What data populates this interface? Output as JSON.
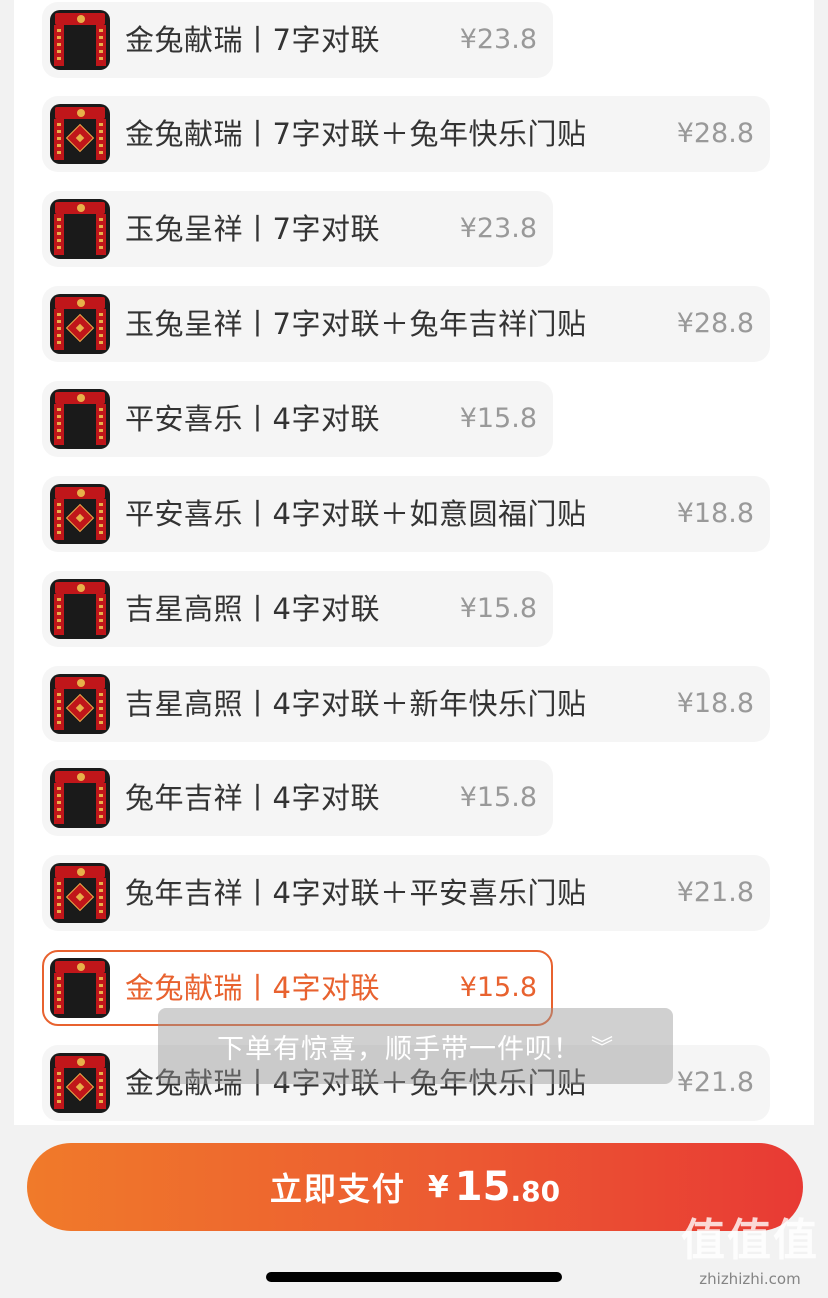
{
  "options": [
    {
      "name": "金兔献瑞丨7字对联",
      "price": "¥23.8",
      "selected": false
    },
    {
      "name": "金兔献瑞丨7字对联＋兔年快乐门贴",
      "price": "¥28.8",
      "selected": false
    },
    {
      "name": "玉兔呈祥丨7字对联",
      "price": "¥23.8",
      "selected": false
    },
    {
      "name": "玉兔呈祥丨7字对联＋兔年吉祥门贴",
      "price": "¥28.8",
      "selected": false
    },
    {
      "name": "平安喜乐丨4字对联",
      "price": "¥15.8",
      "selected": false
    },
    {
      "name": "平安喜乐丨4字对联＋如意圆福门贴",
      "price": "¥18.8",
      "selected": false
    },
    {
      "name": "吉星高照丨4字对联",
      "price": "¥15.8",
      "selected": false
    },
    {
      "name": "吉星高照丨4字对联＋新年快乐门贴",
      "price": "¥18.8",
      "selected": false
    },
    {
      "name": "兔年吉祥丨4字对联",
      "price": "¥15.8",
      "selected": false
    },
    {
      "name": "兔年吉祥丨4字对联＋平安喜乐门贴",
      "price": "¥21.8",
      "selected": false
    },
    {
      "name": "金兔献瑞丨4字对联",
      "price": "¥15.8",
      "selected": true
    },
    {
      "name": "金兔献瑞丨4字对联＋兔年快乐门贴",
      "price": "¥21.8",
      "selected": false
    }
  ],
  "toast": {
    "text": "下单有惊喜，顺手带一件呗！",
    "icon": "double-chevron-down-icon"
  },
  "pay_button": {
    "label": "立即支付",
    "currency": "¥",
    "amount_int": "15",
    "amount_dec": ".80"
  },
  "watermark": {
    "logo": "值值值",
    "url": "zhizhizhi.com"
  },
  "colors": {
    "accent": "#e8622f",
    "button_start": "#f07a2a",
    "button_end": "#e83a34"
  }
}
